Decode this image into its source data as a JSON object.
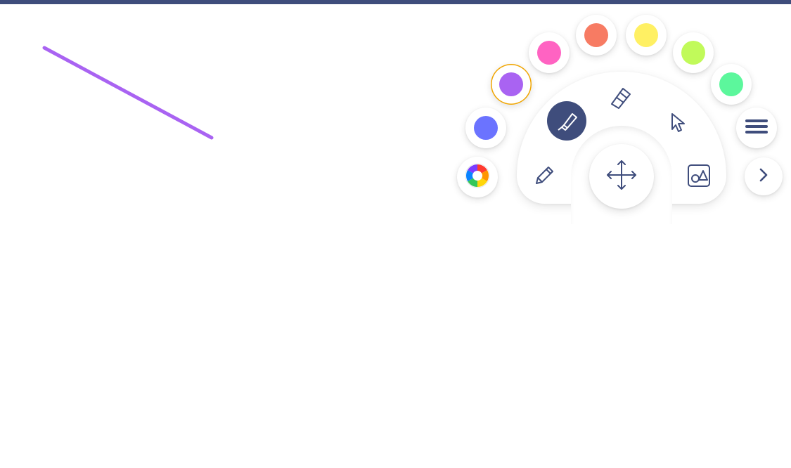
{
  "colors": {
    "top_bar": "#3f4d7c",
    "accent": "#3f4d7c",
    "icon_stroke": "#3f4d7c",
    "selected_ring": "#f0a500",
    "drawn_stroke": "#a963f2"
  },
  "toolbar": {
    "tools": [
      {
        "name": "pencil-tool",
        "icon": "pencil-icon",
        "active": false
      },
      {
        "name": "highlighter-tool",
        "icon": "highlighter-icon",
        "active": true
      },
      {
        "name": "eraser-tool",
        "icon": "eraser-icon",
        "active": false
      },
      {
        "name": "select-tool",
        "icon": "cursor-arrow-icon",
        "active": false
      },
      {
        "name": "shapes-tool",
        "icon": "shapes-icon",
        "active": false
      },
      {
        "name": "move-tool",
        "icon": "move-arrows-icon",
        "active": false
      }
    ],
    "swatches": [
      {
        "name": "swatch-blue",
        "color": "#6b73ff",
        "selected": false
      },
      {
        "name": "swatch-purple",
        "color": "#a963f2",
        "selected": true
      },
      {
        "name": "swatch-pink",
        "color": "#ff63c2",
        "selected": false
      },
      {
        "name": "swatch-coral",
        "color": "#f77b63",
        "selected": false
      },
      {
        "name": "swatch-yellow",
        "color": "#fff063",
        "selected": false
      },
      {
        "name": "swatch-lime",
        "color": "#c1fa5a",
        "selected": false
      },
      {
        "name": "swatch-mint",
        "color": "#5cf79c",
        "selected": false
      }
    ],
    "extras": {
      "color_picker_icon": "color-wheel-icon",
      "menu_icon": "hamburger-menu-icon",
      "next_icon": "chevron-right-icon"
    }
  }
}
